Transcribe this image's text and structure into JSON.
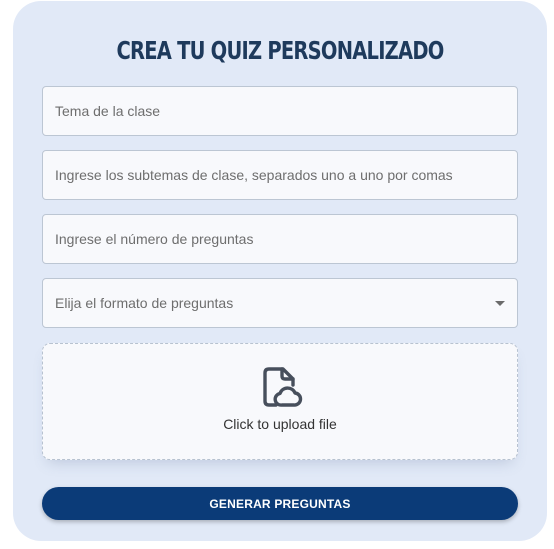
{
  "form": {
    "title": "CREA TU QUIZ PERSONALIZADO",
    "fields": {
      "topic_placeholder": "Tema de la clase",
      "subtopics_placeholder": "Ingrese los subtemas de clase, separados uno a uno por comas",
      "question_count_placeholder": "Ingrese el número de preguntas",
      "format_placeholder": "Elija el formato de preguntas"
    },
    "upload": {
      "icon": "file-cloud-upload-icon",
      "label": "Click to upload file"
    },
    "submit_label": "GENERAR PREGUNTAS"
  },
  "colors": {
    "card_background": "#e1e9f7",
    "title": "#1e3a5c",
    "button": "#0b3b78",
    "field_background": "#f8f9fc",
    "field_border": "#bcc6d3"
  }
}
